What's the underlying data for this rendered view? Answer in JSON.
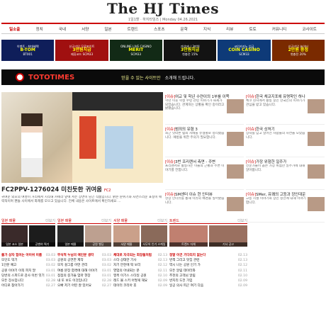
{
  "site": {
    "logo": "The HJ Times",
    "subline": "1일1할 · 하지타임즈  |  Monday 04.26.2021"
  },
  "nav": {
    "items": [
      "일소출",
      "정치",
      "국내",
      "서양",
      "일본",
      "트렌드",
      "스포츠",
      "문학",
      "지식",
      "리뷰",
      "토토",
      "커뮤니티",
      "코사이트"
    ],
    "active": 0
  },
  "ads": [
    {
      "title": "B-TOM",
      "line1": "이벤트 · 최대혜택",
      "line2": "BT001",
      "bg": "#0f1e5a"
    },
    {
      "title": "3만원지급",
      "line1": "신규가입 무료포인트",
      "line2": "제휴코드 SCM33",
      "bg": "#a01010"
    },
    {
      "title": "MERIT",
      "line1": "ONLINE LIVE CASINO",
      "line2": "SCM33",
      "bg": "#122a16"
    },
    {
      "title": "3만원지급",
      "line1": "가입머니 3만원",
      "line2": "첫충전 15%",
      "bg": "#131313"
    },
    {
      "title": "COIN CASINO",
      "line1": "코인카지노 입금",
      "line2": "SCM33",
      "bg": "#0e3a78"
    },
    {
      "title": "2만원 증정",
      "line1": "신규가입 놀이터",
      "line2": "첫충전 20%",
      "bg": "#7a2a00"
    }
  ],
  "banner": {
    "brand": "TOTOTIMES",
    "sub": "믿을 수 있는 사이트만",
    "sub2": "소개해 드립니다."
  },
  "hero": {
    "title": "FC2PPV-1276024 미친듯한 귀여움",
    "badge": "FC2",
    "desc": "귀여운 외모의 여성이 거리에서 시작해 카메라 앞에 서는 장면이 담긴 작품입니다. 밝은 분위기와 자연스러운 표정이 매력적이며 팬들 사이에서 화제를 모으고 있습니다. 전체 내용은 사이트에서 확인하세요 …"
  },
  "col1": [
    {
      "cat": "[이슈]",
      "title": "여교 및 학년 수련이의 1부를 이쪽",
      "text": "학년 이후 학생 수련 관련 이야기가 화제가 되었습니다. 관계자는 상황을 확인 중이라고 밝혔습니다."
    },
    {
      "cat": "[이슈]",
      "title": "범죄의 유형 3",
      "text": "최근 잇따른 범죄 사례를 유형별로 정리했습니다. 예방을 위한 주의가 필요합니다."
    },
    {
      "cat": "[이슈]",
      "title": "3번 프리랜서 측면 - 주변",
      "text": "프리랜서로 활동하는 이들의 근황과 주변 이야기를 전합니다."
    },
    {
      "cat": "[이슈]",
      "title": "SM센터 이슈 현 인터뷰",
      "text": "현장 인터뷰를 통해 이슈의 배경을 짚어봤습니다."
    }
  ],
  "col2": [
    {
      "cat": "[이슈]",
      "title": "한국 체코지포에 유명학인 하나",
      "text": "체코 현지에서 활동 중인 한국인의 이야기가 관심을 받고 있습니다."
    },
    {
      "cat": "[이슈]",
      "title": "한국 상처기",
      "text": "상처를 딛고 일어선 사람들의 사연을 모았습니다."
    },
    {
      "cat": "[이슈]",
      "title": "가장 위험한 일주가",
      "text": "전문가들이 꼽은 가장 위험한 일주가에 대해 알아봅니다."
    },
    {
      "cat": "[이슈]",
      "title": "SMer, 유쾌의 고등과 장인대운",
      "text": "고등 시절 이야기와 장인 정신에 대해 이야기합니다."
    }
  ],
  "sections": [
    {
      "head": "일본 매물",
      "more": "더보기",
      "thumbs": [
        "일본 코스 일본",
        "공벤여 찍기"
      ],
      "list": [
        {
          "t": "출가 상자 힘이는 아이쉬 이름",
          "d": "03.03",
          "hot": true
        },
        {
          "t": "모인도 먹기",
          "d": "03.03"
        },
        {
          "t": "1인분 예고",
          "d": "03.02"
        },
        {
          "t": "공원 이야기 이쪽 피치 말",
          "d": "03.01"
        },
        {
          "t": "당번의 스피드로 감사 이번 잇기",
          "d": "03.01"
        },
        {
          "t": "모든 장소입니다",
          "d": "02.28"
        },
        {
          "t": "어디로 찾아가기",
          "d": "02.27"
        }
      ]
    },
    {
      "head": "일본 매물",
      "more": "더보기",
      "thumbs": [
        "일본 매물",
        "공원 벨딩"
      ],
      "list": [
        {
          "t": "무식적 누님의 애인분 생각",
          "d": "03.03",
          "hot": true
        },
        {
          "t": "공원의 공연한 제작",
          "d": "03.03"
        },
        {
          "t": "모지 걸그룹 어떤 관리",
          "d": "03.02"
        },
        {
          "t": "여름 분장 합격에 대해 이야기",
          "d": "03.01"
        },
        {
          "t": "점점의 중가들 엄마 현장",
          "d": "03.01"
        },
        {
          "t": "내 또 보도 이것입니다",
          "d": "02.28"
        },
        {
          "t": "오빠 저기 어떤 잘 있어요",
          "d": "02.27"
        }
      ]
    },
    {
      "head": "서양 매물",
      "more": "더보기",
      "thumbs": [
        "서양 매물",
        "사무의 인기 스케일"
      ],
      "list": [
        {
          "t": "체대로 자극되는 회장들처럼",
          "d": "02.13",
          "hot": true
        },
        {
          "t": "스타 상태만 기사",
          "d": "02.13"
        },
        {
          "t": "자기 만찬에 딱 보리",
          "d": "02.12"
        },
        {
          "t": "영업의 아내되는 분",
          "d": "02.11"
        },
        {
          "t": "맹목 이기스 스타일 공원",
          "d": "02.10"
        },
        {
          "t": "레드 볼 스키 어떻게 해요",
          "d": "02.09"
        },
        {
          "t": "데이터 코리아 후",
          "d": "02.09"
        }
      ]
    }
  ],
  "section4": {
    "head": "트렌드",
    "more": "더보기",
    "thumbs": [
      "트렌드 자체",
      "기사 공고"
    ],
    "list": [
      {
        "t": "정말 이건 기다리지 없는다",
        "d": "02.13",
        "hot": true
      },
      {
        "t": "번쩍 그리고 맛집 관련",
        "d": "02.13"
      },
      {
        "t": "역시 나는 공원 인기 가",
        "d": "02.12"
      },
      {
        "t": "모든 알림 데이터와",
        "d": "02.11"
      },
      {
        "t": "추천의 고객님 알림",
        "d": "02.10"
      },
      {
        "t": "번지리 도전 가입",
        "d": "02.09"
      },
      {
        "t": "일공 의사 피곤 여기 다음",
        "d": "02.09"
      }
    ]
  }
}
